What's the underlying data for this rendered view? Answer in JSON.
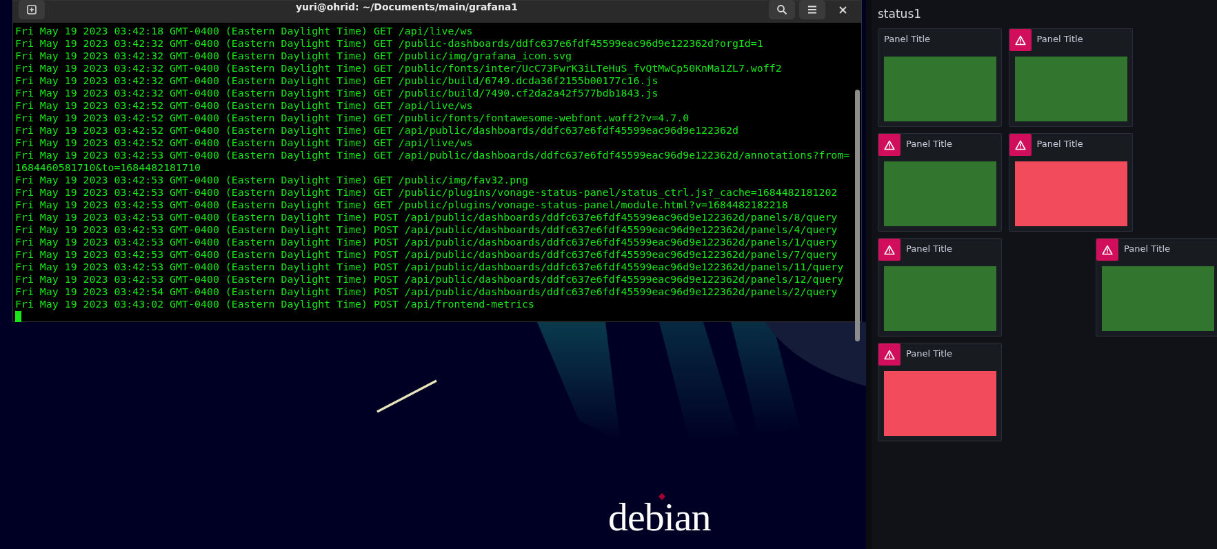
{
  "terminal": {
    "title": "yuri@ohrid: ~/Documents/main/grafana1",
    "lines": [
      "Fri May 19 2023 03:42:18 GMT-0400 (Eastern Daylight Time) GET /api/live/ws",
      "Fri May 19 2023 03:42:32 GMT-0400 (Eastern Daylight Time) GET /public-dashboards/ddfc637e6fdf45599eac96d9e122362d?orgId=1",
      "Fri May 19 2023 03:42:32 GMT-0400 (Eastern Daylight Time) GET /public/img/grafana_icon.svg",
      "Fri May 19 2023 03:42:32 GMT-0400 (Eastern Daylight Time) GET /public/fonts/inter/UcC73FwrK3iLTeHuS_fvQtMwCp50KnMa1ZL7.woff2",
      "Fri May 19 2023 03:42:32 GMT-0400 (Eastern Daylight Time) GET /public/build/6749.dcda36f2155b00177c16.js",
      "Fri May 19 2023 03:42:32 GMT-0400 (Eastern Daylight Time) GET /public/build/7490.cf2da2a42f577bdb1843.js",
      "Fri May 19 2023 03:42:52 GMT-0400 (Eastern Daylight Time) GET /api/live/ws",
      "Fri May 19 2023 03:42:52 GMT-0400 (Eastern Daylight Time) GET /public/fonts/fontawesome-webfont.woff2?v=4.7.0",
      "Fri May 19 2023 03:42:52 GMT-0400 (Eastern Daylight Time) GET /api/public/dashboards/ddfc637e6fdf45599eac96d9e122362d",
      "Fri May 19 2023 03:42:52 GMT-0400 (Eastern Daylight Time) GET /api/live/ws",
      "Fri May 19 2023 03:42:53 GMT-0400 (Eastern Daylight Time) GET /api/public/dashboards/ddfc637e6fdf45599eac96d9e122362d/annotations?from=",
      "1684460581710&to=1684482181710",
      "Fri May 19 2023 03:42:53 GMT-0400 (Eastern Daylight Time) GET /public/img/fav32.png",
      "Fri May 19 2023 03:42:53 GMT-0400 (Eastern Daylight Time) GET /public/plugins/vonage-status-panel/status_ctrl.js?_cache=1684482181202",
      "Fri May 19 2023 03:42:53 GMT-0400 (Eastern Daylight Time) GET /public/plugins/vonage-status-panel/module.html?v=1684482182218",
      "Fri May 19 2023 03:42:53 GMT-0400 (Eastern Daylight Time) POST /api/public/dashboards/ddfc637e6fdf45599eac96d9e122362d/panels/8/query",
      "Fri May 19 2023 03:42:53 GMT-0400 (Eastern Daylight Time) POST /api/public/dashboards/ddfc637e6fdf45599eac96d9e122362d/panels/4/query",
      "Fri May 19 2023 03:42:53 GMT-0400 (Eastern Daylight Time) POST /api/public/dashboards/ddfc637e6fdf45599eac96d9e122362d/panels/1/query",
      "Fri May 19 2023 03:42:53 GMT-0400 (Eastern Daylight Time) POST /api/public/dashboards/ddfc637e6fdf45599eac96d9e122362d/panels/7/query",
      "Fri May 19 2023 03:42:53 GMT-0400 (Eastern Daylight Time) POST /api/public/dashboards/ddfc637e6fdf45599eac96d9e122362d/panels/11/query",
      "Fri May 19 2023 03:42:53 GMT-0400 (Eastern Daylight Time) POST /api/public/dashboards/ddfc637e6fdf45599eac96d9e122362d/panels/12/query",
      "Fri May 19 2023 03:42:54 GMT-0400 (Eastern Daylight Time) POST /api/public/dashboards/ddfc637e6fdf45599eac96d9e122362d/panels/2/query",
      "Fri May 19 2023 03:43:02 GMT-0400 (Eastern Daylight Time) POST /api/frontend-metrics"
    ]
  },
  "desktop": {
    "logo": "debian"
  },
  "dashboard": {
    "title": "status1",
    "panels": [
      {
        "title": "Panel Title",
        "alert": false,
        "color": "#31752e"
      },
      {
        "title": "Panel Title",
        "alert": true,
        "color": "#31752e"
      },
      {
        "title": "Panel Title",
        "alert": true,
        "color": "#31752e"
      },
      {
        "title": "Panel Title",
        "alert": true,
        "color": "#f24b5b"
      },
      {
        "title": "Panel Title",
        "alert": true,
        "color": "#31752e"
      },
      {
        "title": "Panel Title",
        "alert": true,
        "color": "#31752e"
      },
      {
        "title": "Panel Title",
        "alert": true,
        "color": "#f24b5b"
      }
    ]
  }
}
